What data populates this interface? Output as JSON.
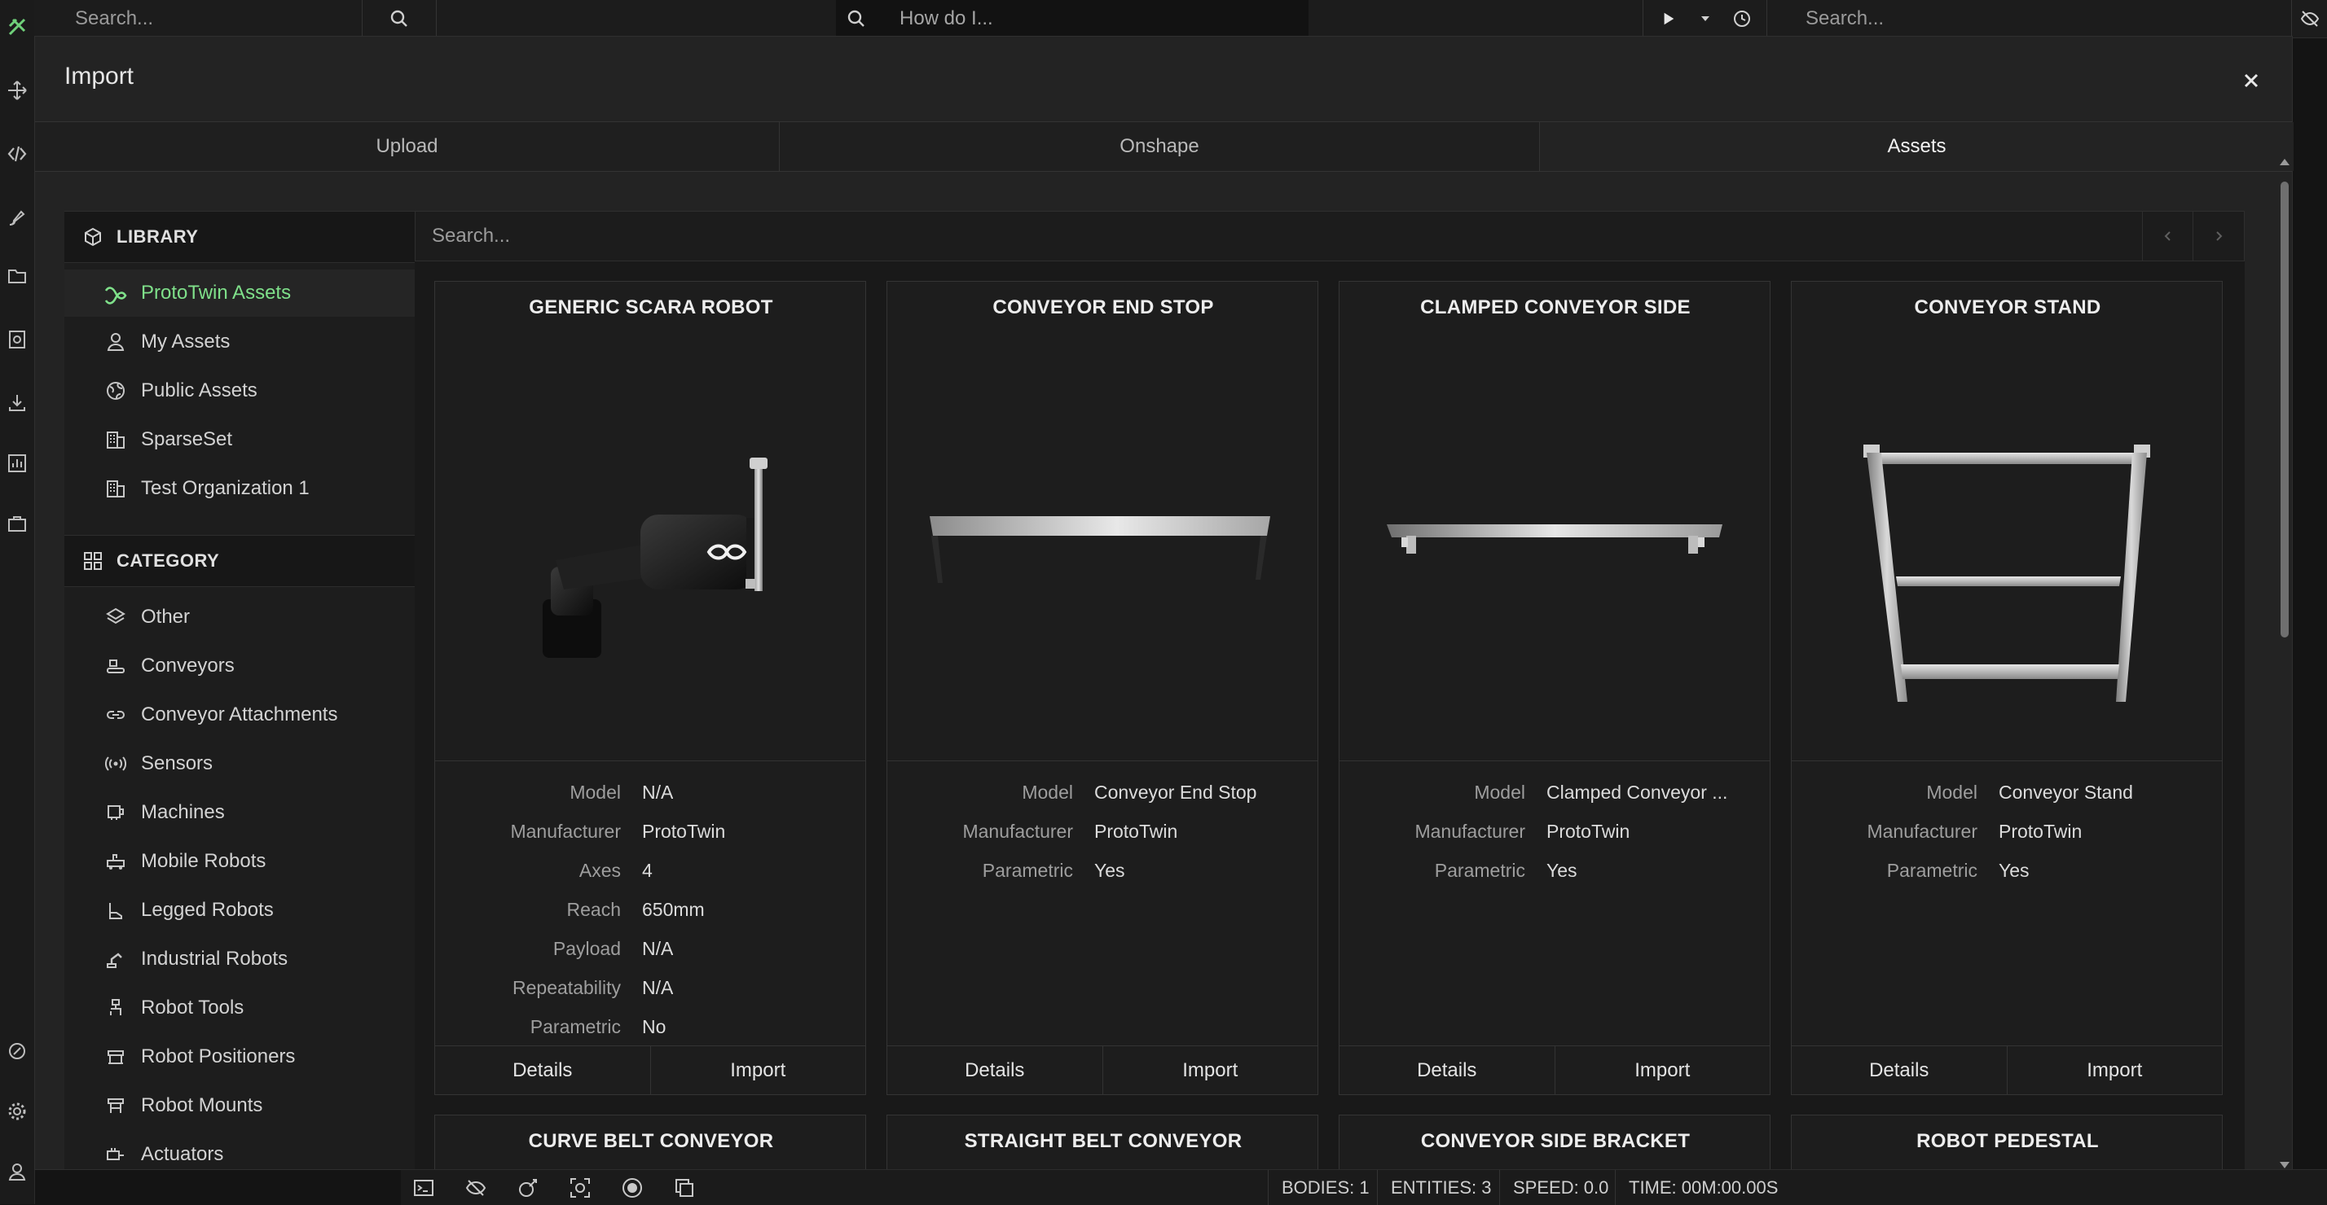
{
  "topbar": {
    "left_search_placeholder": "Search...",
    "center_search_placeholder": "How do I...",
    "right_search_placeholder": "Search..."
  },
  "modal": {
    "title": "Import",
    "tabs": [
      {
        "label": "Upload",
        "active": false
      },
      {
        "label": "Onshape",
        "active": false
      },
      {
        "label": "Assets",
        "active": true
      }
    ]
  },
  "sidebar": {
    "library_heading": "LIBRARY",
    "library_items": [
      {
        "label": "ProtoTwin Assets",
        "icon": "prototwin-logo-icon",
        "active": true
      },
      {
        "label": "My Assets",
        "icon": "user-icon",
        "active": false
      },
      {
        "label": "Public Assets",
        "icon": "globe-icon",
        "active": false
      },
      {
        "label": "SparseSet",
        "icon": "building-icon",
        "active": false
      },
      {
        "label": "Test Organization 1",
        "icon": "building-icon",
        "active": false
      }
    ],
    "category_heading": "CATEGORY",
    "category_items": [
      {
        "label": "Other",
        "icon": "layers-icon"
      },
      {
        "label": "Conveyors",
        "icon": "conveyor-icon"
      },
      {
        "label": "Conveyor Attachments",
        "icon": "link-icon"
      },
      {
        "label": "Sensors",
        "icon": "sensor-icon"
      },
      {
        "label": "Machines",
        "icon": "machine-icon"
      },
      {
        "label": "Mobile Robots",
        "icon": "mobile-robot-icon"
      },
      {
        "label": "Legged Robots",
        "icon": "legged-robot-icon"
      },
      {
        "label": "Industrial Robots",
        "icon": "industrial-robot-icon"
      },
      {
        "label": "Robot Tools",
        "icon": "robot-tool-icon"
      },
      {
        "label": "Robot Positioners",
        "icon": "robot-positioner-icon"
      },
      {
        "label": "Robot Mounts",
        "icon": "robot-mount-icon"
      },
      {
        "label": "Actuators",
        "icon": "actuator-icon"
      }
    ]
  },
  "assets": {
    "search_placeholder": "Search...",
    "cards": [
      {
        "title": "GENERIC SCARA ROBOT",
        "props": [
          {
            "k": "Model",
            "v": "N/A"
          },
          {
            "k": "Manufacturer",
            "v": "ProtoTwin"
          },
          {
            "k": "Axes",
            "v": "4"
          },
          {
            "k": "Reach",
            "v": "650mm"
          },
          {
            "k": "Payload",
            "v": "N/A"
          },
          {
            "k": "Repeatability",
            "v": "N/A"
          },
          {
            "k": "Parametric",
            "v": "No"
          }
        ],
        "details_label": "Details",
        "import_label": "Import"
      },
      {
        "title": "CONVEYOR END STOP",
        "props": [
          {
            "k": "Model",
            "v": "Conveyor End Stop"
          },
          {
            "k": "Manufacturer",
            "v": "ProtoTwin"
          },
          {
            "k": "Parametric",
            "v": "Yes"
          }
        ],
        "details_label": "Details",
        "import_label": "Import"
      },
      {
        "title": "CLAMPED CONVEYOR SIDE",
        "props": [
          {
            "k": "Model",
            "v": "Clamped Conveyor ..."
          },
          {
            "k": "Manufacturer",
            "v": "ProtoTwin"
          },
          {
            "k": "Parametric",
            "v": "Yes"
          }
        ],
        "details_label": "Details",
        "import_label": "Import"
      },
      {
        "title": "CONVEYOR STAND",
        "props": [
          {
            "k": "Model",
            "v": "Conveyor Stand"
          },
          {
            "k": "Manufacturer",
            "v": "ProtoTwin"
          },
          {
            "k": "Parametric",
            "v": "Yes"
          }
        ],
        "details_label": "Details",
        "import_label": "Import"
      }
    ],
    "next_row_titles": [
      "CURVE BELT CONVEYOR",
      "STRAIGHT BELT CONVEYOR",
      "CONVEYOR SIDE BRACKET",
      "ROBOT PEDESTAL"
    ]
  },
  "statusbar": {
    "bodies": "BODIES: 1",
    "entities": "ENTITIES: 3",
    "speed": "SPEED: 0.0",
    "time": "TIME: 00M:00.00S"
  },
  "colors": {
    "accent_green": "#7fe08a",
    "background": "#141414",
    "modal": "#232323"
  }
}
